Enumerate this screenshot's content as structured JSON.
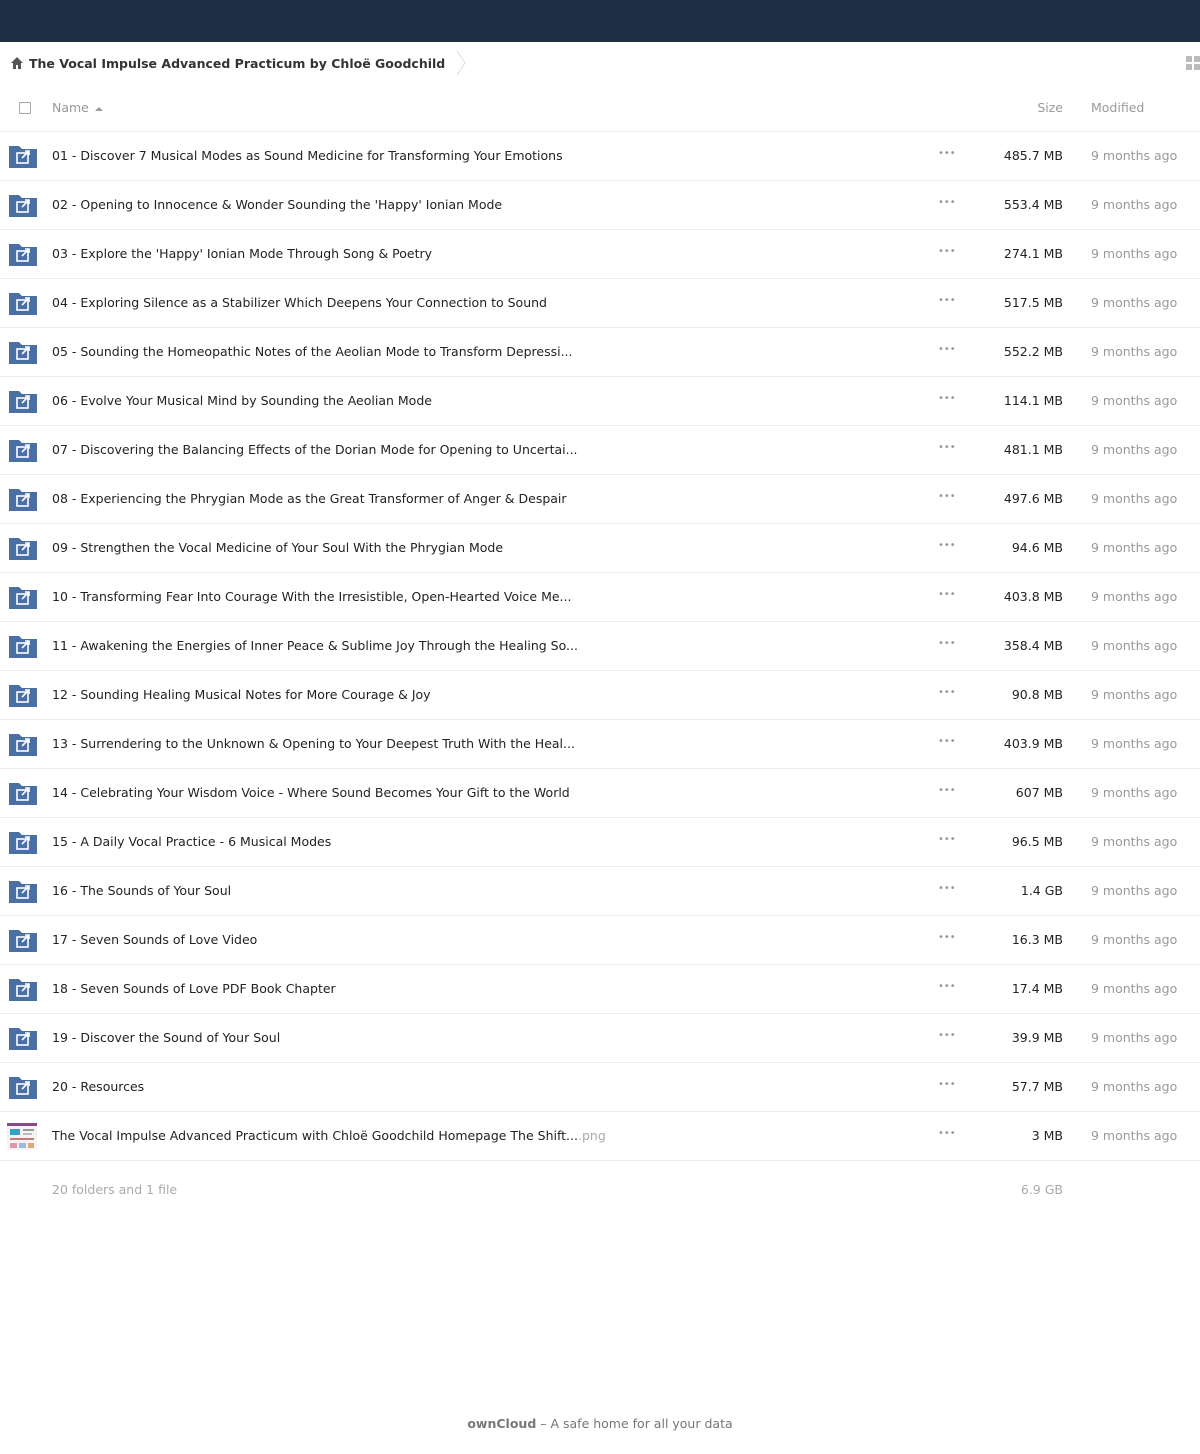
{
  "breadcrumb": {
    "folder": "The Vocal Impulse Advanced Practicum by Chloë Goodchild"
  },
  "columns": {
    "name": "Name",
    "size": "Size",
    "modified": "Modified"
  },
  "files": [
    {
      "name": "01 - Discover 7 Musical Modes as Sound Medicine for Transforming Your Emotions",
      "ext": "",
      "type": "folder",
      "size": "485.7 MB",
      "modified": "9 months ago"
    },
    {
      "name": "02 - Opening to Innocence & Wonder Sounding the 'Happy' Ionian Mode",
      "ext": "",
      "type": "folder",
      "size": "553.4 MB",
      "modified": "9 months ago"
    },
    {
      "name": "03 - Explore the 'Happy' Ionian Mode Through Song & Poetry",
      "ext": "",
      "type": "folder",
      "size": "274.1 MB",
      "modified": "9 months ago"
    },
    {
      "name": "04 - Exploring Silence as a Stabilizer Which Deepens Your Connection to Sound",
      "ext": "",
      "type": "folder",
      "size": "517.5 MB",
      "modified": "9 months ago"
    },
    {
      "name": "05 - Sounding the Homeopathic Notes of the Aeolian Mode to Transform Depressi...",
      "ext": "",
      "type": "folder",
      "size": "552.2 MB",
      "modified": "9 months ago"
    },
    {
      "name": "06 - Evolve Your Musical Mind by Sounding the Aeolian Mode",
      "ext": "",
      "type": "folder",
      "size": "114.1 MB",
      "modified": "9 months ago"
    },
    {
      "name": "07 - Discovering the Balancing Effects of the Dorian Mode for Opening to Uncertai...",
      "ext": "",
      "type": "folder",
      "size": "481.1 MB",
      "modified": "9 months ago"
    },
    {
      "name": "08 - Experiencing the Phrygian Mode as the Great Transformer of Anger & Despair",
      "ext": "",
      "type": "folder",
      "size": "497.6 MB",
      "modified": "9 months ago"
    },
    {
      "name": "09 - Strengthen the Vocal Medicine of Your Soul With the Phrygian Mode",
      "ext": "",
      "type": "folder",
      "size": "94.6 MB",
      "modified": "9 months ago"
    },
    {
      "name": "10 - Transforming Fear Into Courage With the Irresistible, Open-Hearted Voice Me...",
      "ext": "",
      "type": "folder",
      "size": "403.8 MB",
      "modified": "9 months ago"
    },
    {
      "name": "11 - Awakening the Energies of Inner Peace & Sublime Joy Through the Healing So...",
      "ext": "",
      "type": "folder",
      "size": "358.4 MB",
      "modified": "9 months ago"
    },
    {
      "name": "12 - Sounding Healing Musical Notes for More Courage & Joy",
      "ext": "",
      "type": "folder",
      "size": "90.8 MB",
      "modified": "9 months ago"
    },
    {
      "name": "13 - Surrendering to the Unknown & Opening to Your Deepest Truth With the Heal...",
      "ext": "",
      "type": "folder",
      "size": "403.9 MB",
      "modified": "9 months ago"
    },
    {
      "name": "14 - Celebrating Your Wisdom Voice - Where Sound Becomes Your Gift to the World",
      "ext": "",
      "type": "folder",
      "size": "607 MB",
      "modified": "9 months ago"
    },
    {
      "name": "15 - A Daily Vocal Practice - 6 Musical Modes",
      "ext": "",
      "type": "folder",
      "size": "96.5 MB",
      "modified": "9 months ago"
    },
    {
      "name": "16 - The Sounds of Your Soul",
      "ext": "",
      "type": "folder",
      "size": "1.4 GB",
      "modified": "9 months ago"
    },
    {
      "name": "17 - Seven Sounds of Love Video",
      "ext": "",
      "type": "folder",
      "size": "16.3 MB",
      "modified": "9 months ago"
    },
    {
      "name": "18 - Seven Sounds of Love PDF Book Chapter",
      "ext": "",
      "type": "folder",
      "size": "17.4 MB",
      "modified": "9 months ago"
    },
    {
      "name": "19 - Discover the Sound of Your Soul",
      "ext": "",
      "type": "folder",
      "size": "39.9 MB",
      "modified": "9 months ago"
    },
    {
      "name": "20 - Resources",
      "ext": "",
      "type": "folder",
      "size": "57.7 MB",
      "modified": "9 months ago"
    },
    {
      "name": "The Vocal Impulse Advanced Practicum with Chloë Goodchild Homepage The Shift...",
      "ext": ".png",
      "type": "image",
      "size": "3 MB",
      "modified": "9 months ago"
    }
  ],
  "more_label": "•••",
  "summary": {
    "count": "20 folders and 1 file",
    "total_size": "6.9 GB"
  },
  "footer": {
    "brand": "ownCloud",
    "tagline": " – A safe home for all your data"
  },
  "colors": {
    "topbar": "#1d2d44",
    "folder": "#4a6fa5"
  }
}
